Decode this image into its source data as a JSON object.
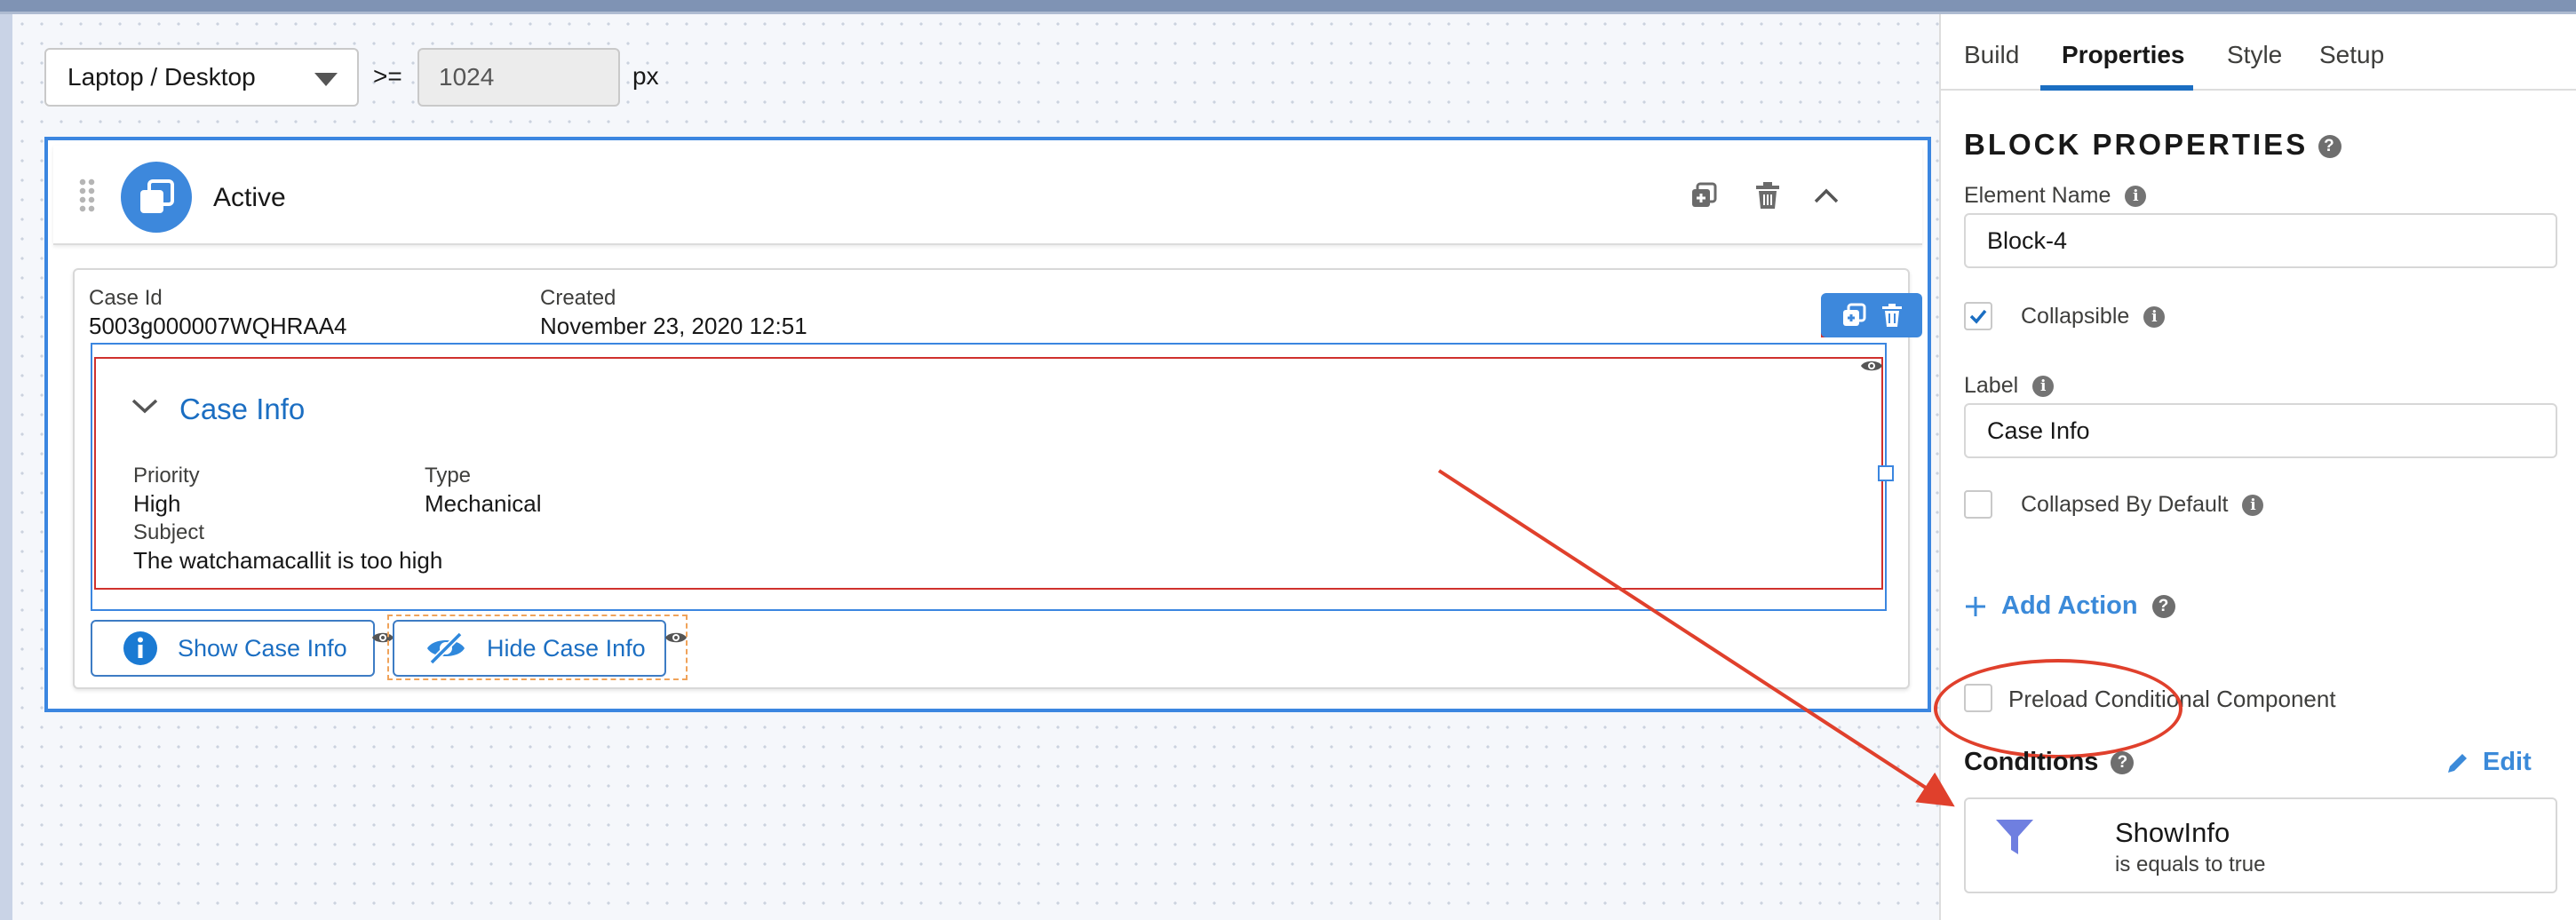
{
  "toolbar": {
    "device_value": "Laptop / Desktop",
    "operator": ">=",
    "breakpoint_value": "1024",
    "unit": "px"
  },
  "block": {
    "title": "Active"
  },
  "case": {
    "case_id_label": "Case Id",
    "case_id_value": "5003g000007WQHRAA4",
    "created_label": "Created",
    "created_value": "November 23, 2020 12:51",
    "section_title": "Case Info",
    "priority_label": "Priority",
    "priority_value": "High",
    "type_label": "Type",
    "type_value": "Mechanical",
    "subject_label": "Subject",
    "subject_value": "The watchamacallit is too high"
  },
  "actions": {
    "show_label": "Show Case Info",
    "hide_label": "Hide Case Info"
  },
  "panel": {
    "tabs": [
      "Build",
      "Properties",
      "Style",
      "Setup"
    ],
    "active_tab": "Properties",
    "section_title": "BLOCK PROPERTIES",
    "element_name_label": "Element Name",
    "element_name_value": "Block-4",
    "collapsible_label": "Collapsible",
    "collapsible_checked": true,
    "label_label": "Label",
    "label_value": "Case Info",
    "collapsed_default_label": "Collapsed By Default",
    "collapsed_default_checked": false,
    "add_action_label": "Add Action",
    "preload_label": "Preload Conditional Component",
    "preload_checked": false,
    "conditions_label": "Conditions",
    "edit_label": "Edit",
    "condition_name": "ShowInfo",
    "condition_desc": "is equals to true"
  },
  "colors": {
    "accent": "#1b6ec2",
    "selection": "#3b86e0",
    "highlight_red": "#d0312d",
    "annotation": "#e0402c"
  },
  "icons": {
    "grip": "drag-grip-icon",
    "block": "stacked-squares-icon",
    "copy": "duplicate-icon",
    "delete": "trash-icon",
    "collapse": "chevron-up-icon",
    "section_toggle": "chevron-down-icon",
    "visibility": "eye-icon",
    "info": "info-circle-icon",
    "hide": "eye-slash-icon",
    "help": "question-icon",
    "add": "plus-icon",
    "edit": "pencil-icon",
    "filter": "funnel-icon"
  }
}
